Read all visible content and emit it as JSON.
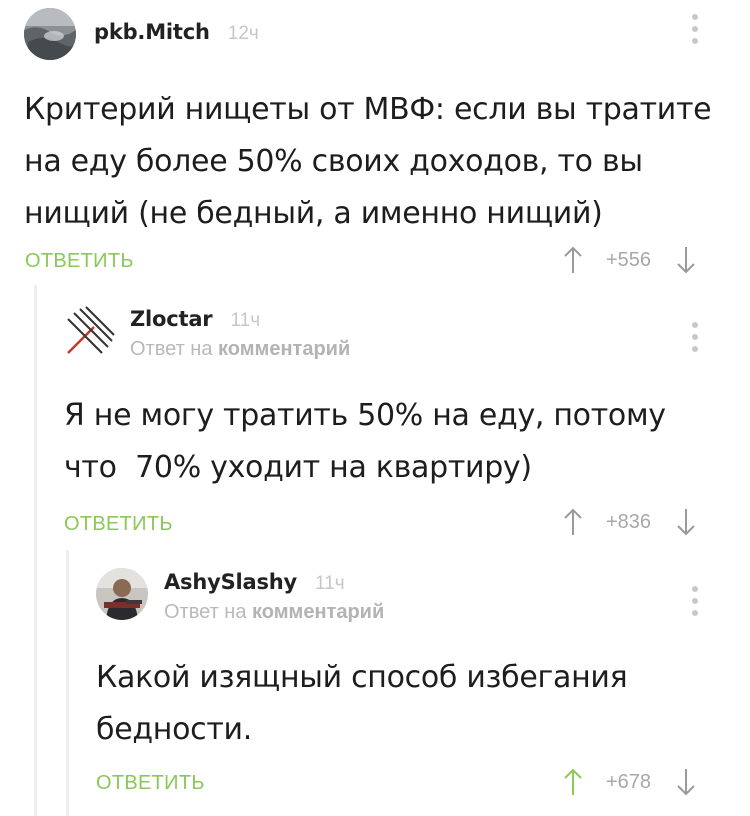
{
  "comments": [
    {
      "author": "pkb.Mitch",
      "time": "12ч",
      "reply_to_prefix": "",
      "reply_to_link": "",
      "text_lines": [
        "Критерий нищеты от МВФ: если вы тратите",
        "на еду более 50% своих доходов, то вы",
        "нищий (не бедный, а именно нищий)"
      ],
      "reply_label": "ОТВЕТИТЬ",
      "score": "+556",
      "avatar_icon": "ocean-photo-avatar"
    },
    {
      "author": "Zloctar",
      "time": "11ч",
      "reply_to_prefix": "Ответ на",
      "reply_to_link": "комментарий",
      "text_lines": [
        "Я не могу тратить 50% на еду, потому",
        "что  70% уходит на квартиру)"
      ],
      "reply_label": "ОТВЕТИТЬ",
      "score": "+836",
      "avatar_icon": "slash-lines-avatar"
    },
    {
      "author": "AshySlashy",
      "time": "11ч",
      "reply_to_prefix": "Ответ на",
      "reply_to_link": "комментарий",
      "text_lines": [
        "Какой изящный способ избегания",
        "бедности."
      ],
      "reply_label": "ОТВЕТИТЬ",
      "score": "+678",
      "avatar_icon": "person-photo-avatar"
    }
  ],
  "colors": {
    "reply_green": "#8ac858",
    "muted_gray": "#b9b9b9",
    "text_dark": "#1d1d1d"
  }
}
